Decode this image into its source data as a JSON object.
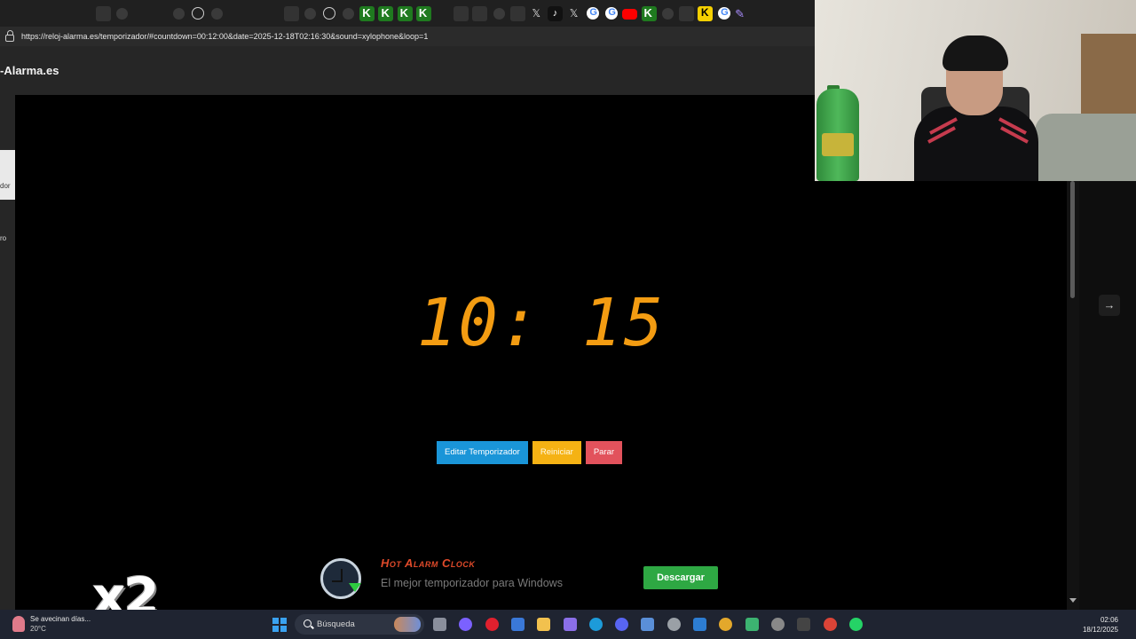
{
  "browser": {
    "url": "https://reloj-alarma.es/temporizador/#countdown=00:12:00&date=2025-12-18T02:16:30&sound=xylophone&loop=1",
    "tabs": [
      "instagram",
      "instagram",
      "instagram",
      "instagram",
      "instagram",
      "dark",
      "gray",
      "instagram",
      "instagram",
      "gray",
      "globe",
      "gray",
      "instagram",
      "instagram",
      "instagram",
      "dark",
      "gray",
      "globe",
      "gray",
      "green",
      "green",
      "green",
      "green",
      "instagram",
      "dark",
      "dark",
      "gray",
      "dark",
      "x",
      "tiktok",
      "x",
      "google",
      "google",
      "yt",
      "green",
      "gray",
      "dark",
      "yellow",
      "google",
      "pencil"
    ]
  },
  "site": {
    "brand": "-Alarma.es",
    "sidebar_item_1": "dor",
    "sidebar_item_2": "ro"
  },
  "timer": {
    "display": "10: 15"
  },
  "buttons": {
    "edit": "Editar Temporizador",
    "reset": "Reiniciar",
    "stop": "Parar"
  },
  "ad": {
    "title": "Hot Alarm Clock",
    "subtitle": "El mejor temporizador para Windows",
    "download": "Descargar"
  },
  "overlay": {
    "watermark": "x2"
  },
  "taskbar": {
    "weather_text": "Se avecinan días...",
    "weather_temp": "20°C",
    "search_placeholder": "Búsqueda",
    "time": "02:06",
    "date": "18/12/2025",
    "icons": [
      "task-view",
      "copilot",
      "opera",
      "store",
      "folder",
      "pen",
      "edge",
      "discord",
      "photos",
      "settings",
      "app",
      "chrome-canary",
      "app2",
      "camera",
      "terminal",
      "chrome",
      "whatsapp"
    ]
  },
  "colors": {
    "timer": "#f39c12",
    "edit_btn": "#1a95d8",
    "reset_btn": "#f5b214",
    "stop_btn": "#e2525c",
    "download_btn": "#2ea843"
  }
}
